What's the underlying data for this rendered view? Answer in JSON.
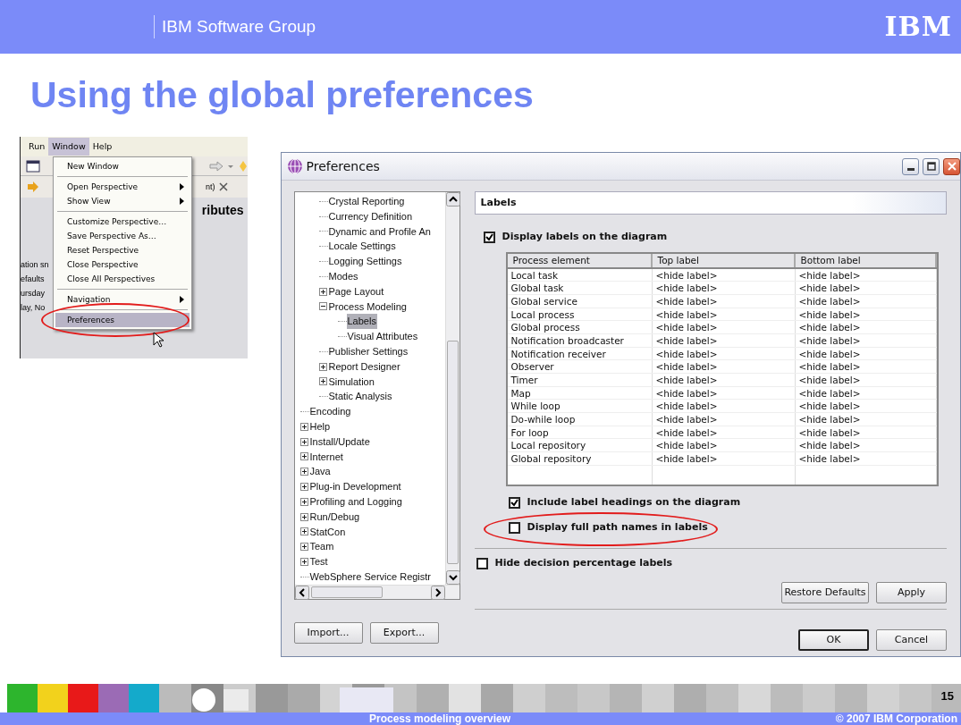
{
  "header": {
    "group": "IBM Software Group",
    "logo": "IBM"
  },
  "title": "Using the global preferences",
  "eclipse_menu": {
    "menubar": [
      {
        "label": "Run",
        "selected": false
      },
      {
        "label": "Window",
        "selected": true
      },
      {
        "label": "Help",
        "selected": false
      }
    ],
    "background_tab": "nt)",
    "background_heading": "ributes",
    "background_lines": [
      "ation sn",
      "efaults",
      "ursday",
      "lay, No"
    ],
    "groups": [
      [
        {
          "label": "New Window",
          "submenu": false,
          "selected": false
        }
      ],
      [
        {
          "label": "Open Perspective",
          "submenu": true,
          "selected": false
        },
        {
          "label": "Show View",
          "submenu": true,
          "selected": false
        }
      ],
      [
        {
          "label": "Customize Perspective…",
          "submenu": false,
          "selected": false
        },
        {
          "label": "Save Perspective As…",
          "submenu": false,
          "selected": false
        },
        {
          "label": "Reset Perspective",
          "submenu": false,
          "selected": false
        },
        {
          "label": "Close Perspective",
          "submenu": false,
          "selected": false
        },
        {
          "label": "Close All Perspectives",
          "submenu": false,
          "selected": false
        }
      ],
      [
        {
          "label": "Navigation",
          "submenu": true,
          "selected": false
        }
      ],
      [
        {
          "label": "Preferences",
          "submenu": false,
          "selected": true
        }
      ]
    ]
  },
  "dialog": {
    "title": "Preferences",
    "tree": {
      "scrolled_parent_children": [
        {
          "label": "Crystal Reporting",
          "selected": false
        },
        {
          "label": "Currency Definition",
          "selected": false
        },
        {
          "label": "Dynamic and Profile An",
          "selected": false
        },
        {
          "label": "Locale Settings",
          "selected": false
        },
        {
          "label": "Logging Settings",
          "selected": false
        },
        {
          "label": "Modes",
          "selected": false
        },
        {
          "label": "Page Layout",
          "has_children": true,
          "expanded": false,
          "selected": false
        },
        {
          "label": "Process Modeling",
          "has_children": true,
          "expanded": true,
          "selected": false,
          "children": [
            {
              "label": "Labels",
              "selected": true
            },
            {
              "label": "Visual Attributes",
              "selected": false
            }
          ]
        },
        {
          "label": "Publisher Settings",
          "selected": false
        },
        {
          "label": "Report Designer",
          "has_children": true,
          "expanded": false,
          "selected": false
        },
        {
          "label": "Simulation",
          "has_children": true,
          "expanded": false,
          "selected": false
        },
        {
          "label": "Static Analysis",
          "selected": false
        }
      ],
      "items": [
        {
          "label": "Encoding",
          "selected": false
        },
        {
          "label": "Help",
          "has_children": true,
          "expanded": false,
          "selected": false
        },
        {
          "label": "Install/Update",
          "has_children": true,
          "expanded": false,
          "selected": false
        },
        {
          "label": "Internet",
          "has_children": true,
          "expanded": false,
          "selected": false
        },
        {
          "label": "Java",
          "has_children": true,
          "expanded": false,
          "selected": false
        },
        {
          "label": "Plug-in Development",
          "has_children": true,
          "expanded": false,
          "selected": false
        },
        {
          "label": "Profiling and Logging",
          "has_children": true,
          "expanded": false,
          "selected": false
        },
        {
          "label": "Run/Debug",
          "has_children": true,
          "expanded": false,
          "selected": false
        },
        {
          "label": "StatCon",
          "has_children": true,
          "expanded": false,
          "selected": false
        },
        {
          "label": "Team",
          "has_children": true,
          "expanded": false,
          "selected": false
        },
        {
          "label": "Test",
          "has_children": true,
          "expanded": false,
          "selected": false
        },
        {
          "label": "WebSphere Service Registr",
          "selected": false
        }
      ]
    },
    "left_buttons": [
      "Import...",
      "Export..."
    ],
    "page_title": "Labels",
    "display_labels": {
      "label": "Display labels on the diagram",
      "checked": true
    },
    "table": {
      "columns": [
        "Process element",
        "Top label",
        "Bottom label"
      ],
      "rows": [
        [
          "Local task",
          "<hide label>",
          "<hide label>"
        ],
        [
          "Global task",
          "<hide label>",
          "<hide label>"
        ],
        [
          "Global service",
          "<hide label>",
          "<hide label>"
        ],
        [
          "Local process",
          "<hide label>",
          "<hide label>"
        ],
        [
          "Global process",
          "<hide label>",
          "<hide label>"
        ],
        [
          "Notification broadcaster",
          "<hide label>",
          "<hide label>"
        ],
        [
          "Notification receiver",
          "<hide label>",
          "<hide label>"
        ],
        [
          "Observer",
          "<hide label>",
          "<hide label>"
        ],
        [
          "Timer",
          "<hide label>",
          "<hide label>"
        ],
        [
          "Map",
          "<hide label>",
          "<hide label>"
        ],
        [
          "While loop",
          "<hide label>",
          "<hide label>"
        ],
        [
          "Do-while loop",
          "<hide label>",
          "<hide label>"
        ],
        [
          "For loop",
          "<hide label>",
          "<hide label>"
        ],
        [
          "Local repository",
          "<hide label>",
          "<hide label>"
        ],
        [
          "Global repository",
          "<hide label>",
          "<hide label>"
        ]
      ]
    },
    "sub_options": [
      {
        "label": "Include label headings on the diagram",
        "checked": true,
        "highlighted": false
      },
      {
        "label": "Display full path names in labels",
        "checked": false,
        "highlighted": true
      }
    ],
    "hide_decision": {
      "label": "Hide decision percentage labels",
      "checked": false
    },
    "page_buttons": [
      "Restore Defaults",
      "Apply"
    ],
    "dialog_buttons": [
      {
        "label": "OK",
        "default": true
      },
      {
        "label": "Cancel",
        "default": false
      }
    ]
  },
  "footer": {
    "page": "15",
    "subject": "Process modeling overview",
    "copyright": "© 2007 IBM Corporation"
  }
}
